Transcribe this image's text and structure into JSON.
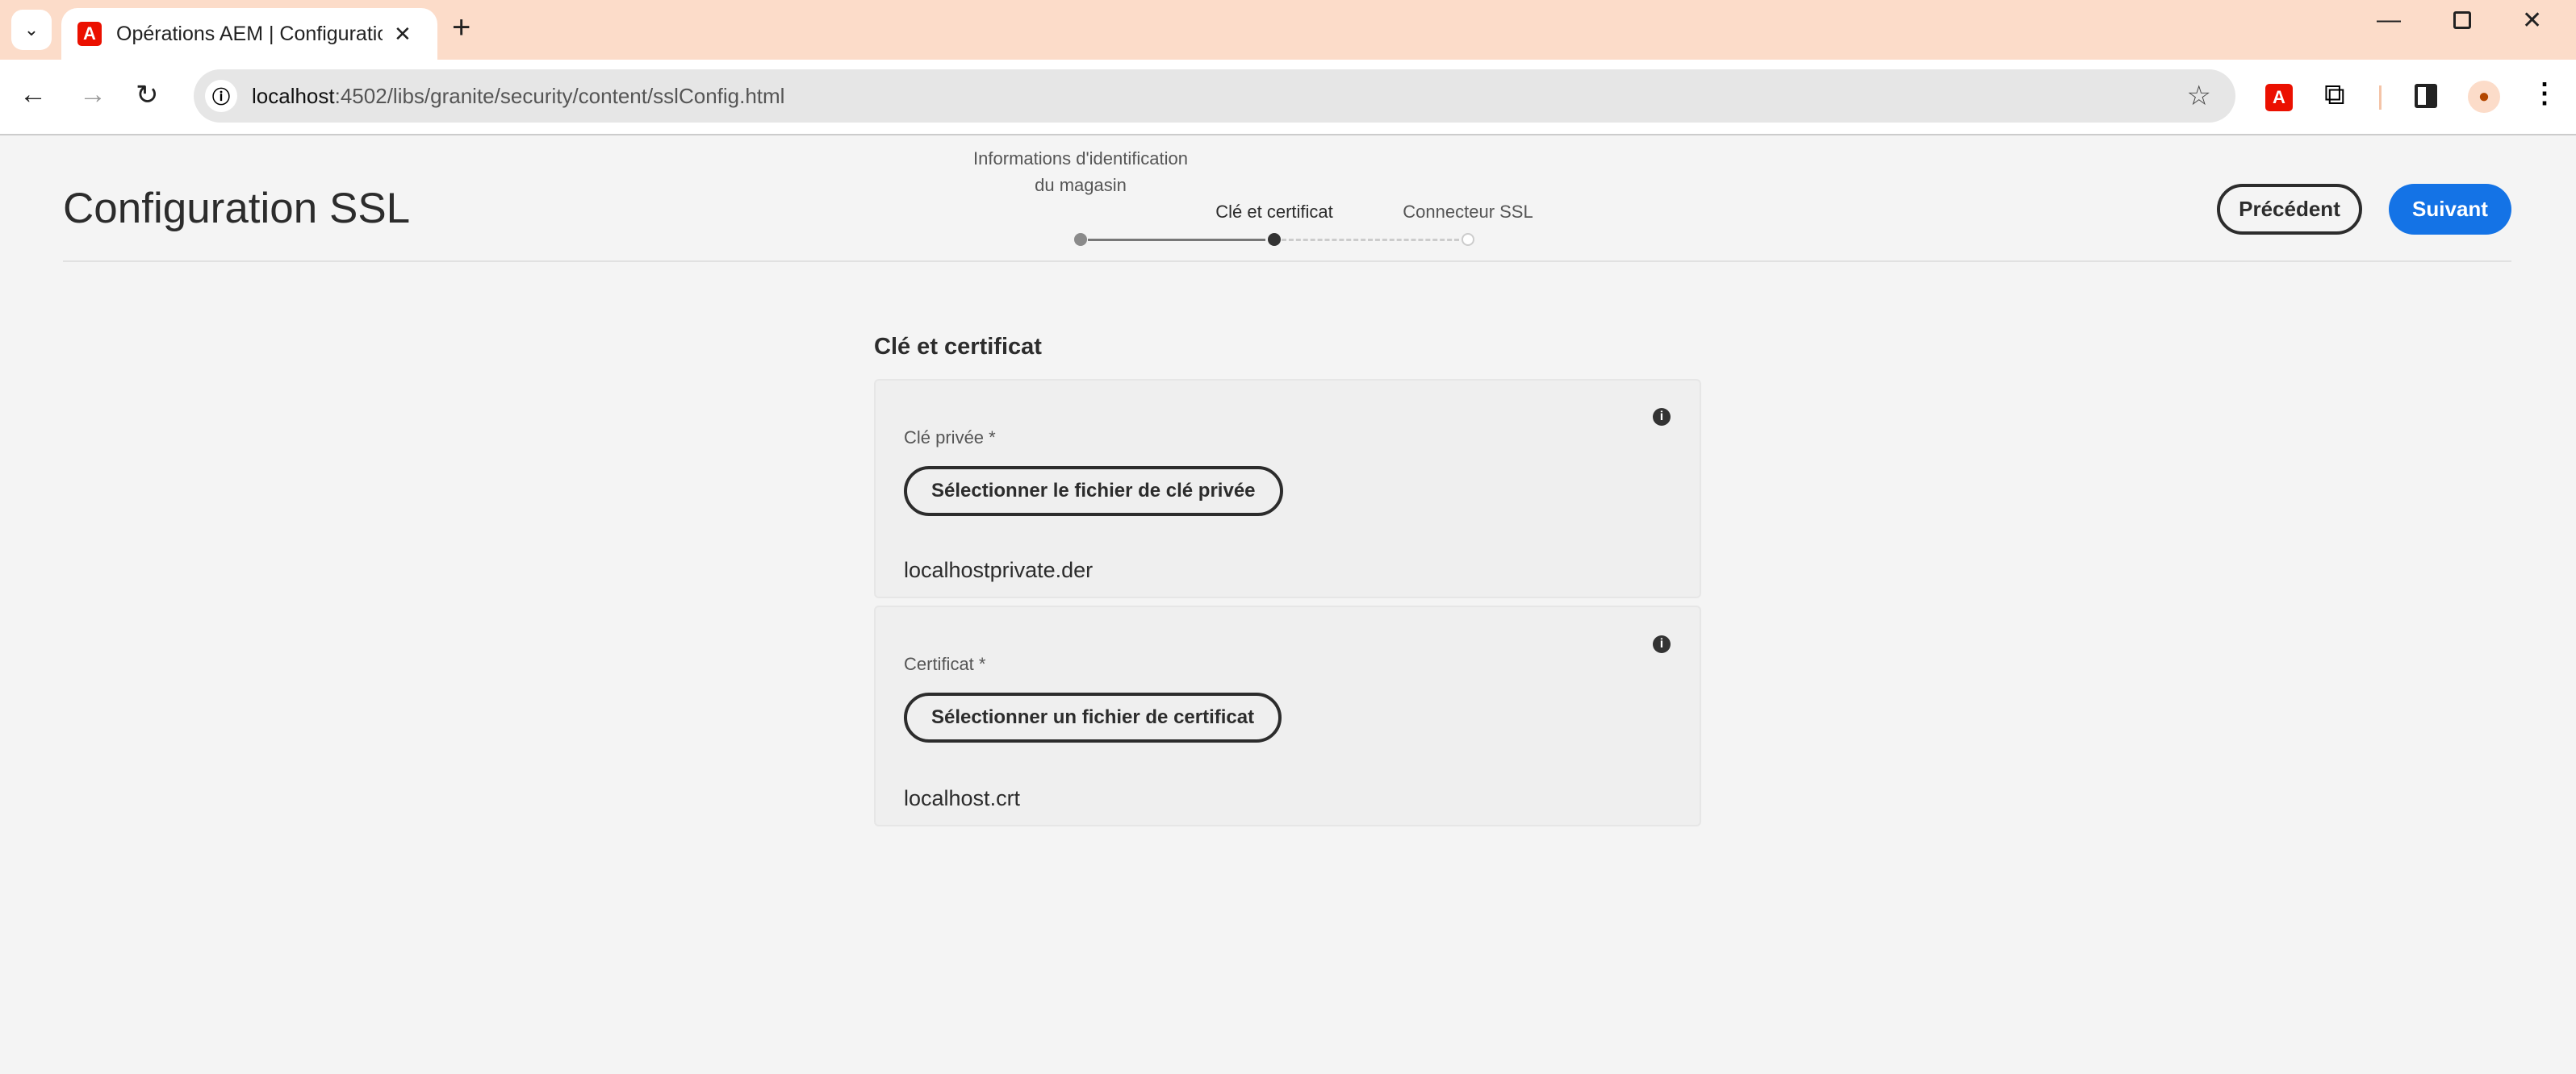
{
  "browser": {
    "tab_title": "Opérations AEM | Configuration SSL",
    "url_host": "localhost",
    "url_rest": ":4502/libs/granite/security/content/sslConfig.html"
  },
  "page": {
    "title": "Configuration SSL",
    "steps": [
      {
        "label": "Informations d'identification du magasin",
        "state": "completed"
      },
      {
        "label": "Clé et certificat",
        "state": "current"
      },
      {
        "label": "Connecteur SSL",
        "state": "upcoming"
      }
    ],
    "prev_label": "Précédent",
    "next_label": "Suivant",
    "accent_color": "#1473e6",
    "section_title": "Clé et certificat",
    "fields": [
      {
        "label": "Clé privée *",
        "button": "Sélectionner le fichier de clé privée",
        "file": "localhostprivate.der"
      },
      {
        "label": "Certificat *",
        "button": "Sélectionner un fichier de certificat",
        "file": "localhost.crt"
      }
    ]
  }
}
